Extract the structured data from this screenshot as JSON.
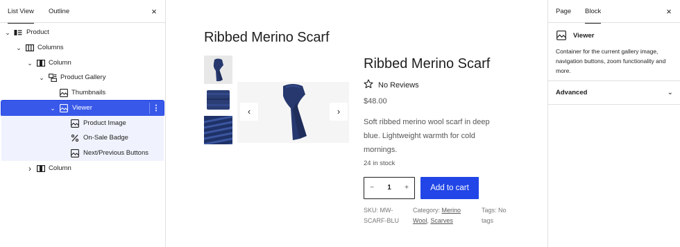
{
  "left_panel": {
    "tabs": [
      "List View",
      "Outline"
    ],
    "close": "×",
    "tree": [
      {
        "label": "Product",
        "chev": "⌄",
        "icon": "product-icon"
      },
      {
        "label": "Columns",
        "chev": "⌄",
        "icon": "columns-icon"
      },
      {
        "label": "Column",
        "chev": "⌄",
        "icon": "column-icon"
      },
      {
        "label": "Product Gallery",
        "chev": "⌄",
        "icon": "gallery-icon"
      },
      {
        "label": "Thumbnails",
        "chev": "",
        "icon": "image-icon"
      },
      {
        "label": "Viewer",
        "chev": "⌄",
        "icon": "image-icon",
        "options": "⋮"
      },
      {
        "label": "Product Image",
        "chev": "",
        "icon": "image-icon"
      },
      {
        "label": "On-Sale Badge",
        "chev": "",
        "icon": "percent-icon"
      },
      {
        "label": "Next/Previous Buttons",
        "chev": "",
        "icon": "image-icon"
      },
      {
        "label": "Column",
        "chev": "›",
        "icon": "column-icon"
      }
    ]
  },
  "canvas": {
    "page_title": "Ribbed Merino Scarf",
    "product_title": "Ribbed Merino Scarf",
    "reviews": "No Reviews",
    "price": "$48.00",
    "description": "Soft ribbed merino wool scarf in deep blue. Lightweight warmth for cold mornings.",
    "stock": "24 in stock",
    "quantity": {
      "minus": "−",
      "value": "1",
      "plus": "+"
    },
    "add_to_cart": "Add to cart",
    "gallery_prev": "‹",
    "gallery_next": "›",
    "meta": {
      "sku_line1": "SKU: MW-",
      "sku_line2": "SCARF-BLU",
      "category_label": "Category: ",
      "category_link1": "Merino",
      "category_link2": "Wool",
      "category_sep": ", ",
      "category_link3": "Scarves",
      "tags_line1": "Tags: No",
      "tags_line2": "tags"
    }
  },
  "right_panel": {
    "tabs": [
      "Page",
      "Block"
    ],
    "close": "×",
    "block_name": "Viewer",
    "block_description": "Container for the current gallery image, navigation buttons, zoom functionality and more.",
    "advanced_label": "Advanced",
    "advanced_chev": "⌄"
  },
  "colors": {
    "accent": "#3858e9",
    "button": "#2145e6",
    "scarf": "#26386e"
  }
}
